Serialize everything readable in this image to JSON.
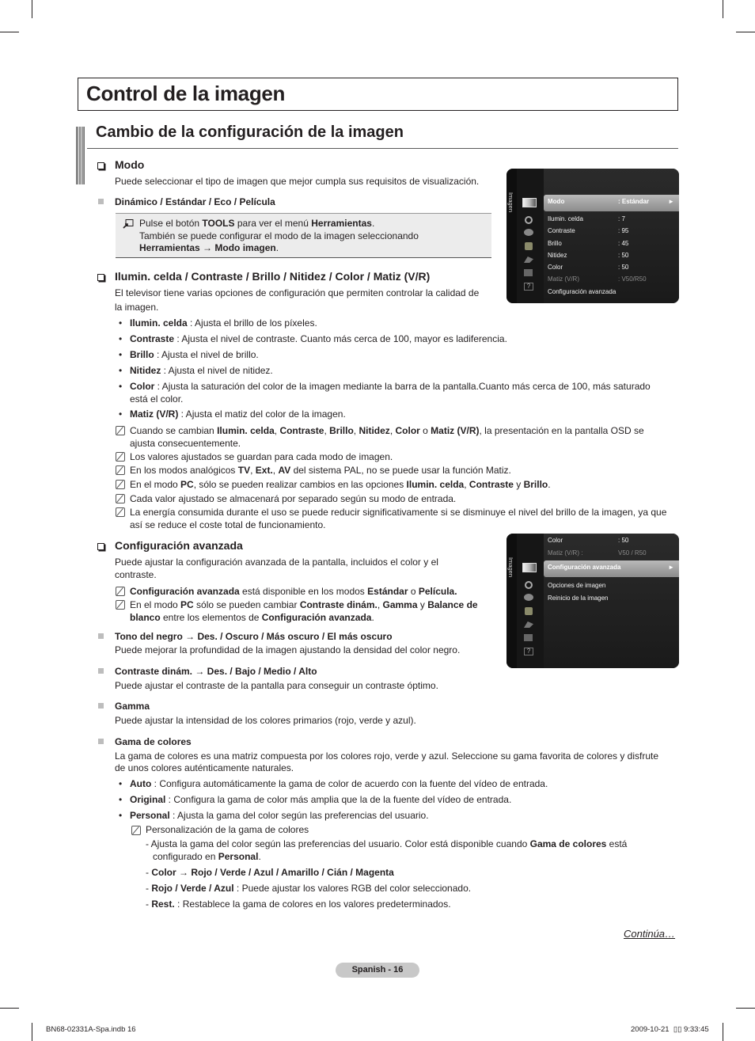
{
  "page": {
    "title": "Control de la imagen",
    "section_title": "Cambio de la configuración de la imagen",
    "continue_label": "Continúa…",
    "page_label": "Spanish - 16",
    "footer_left": "BN68-02331A-Spa.indb   16",
    "footer_right": "2009-10-21   \u0000 9:33:45"
  },
  "modo": {
    "heading": "Modo",
    "desc": "Puede seleccionar el tipo de imagen que mejor cumpla sus requisitos de visualización.",
    "options": [
      "Dinámico",
      "Estándar",
      "Eco",
      "Película"
    ],
    "tools_line1_a": "Pulse el botón ",
    "tools_line1_b": "TOOLS",
    "tools_line1_c": " para ver el menú ",
    "tools_line1_d": "Herramientas",
    "tools_line2": "También se puede configurar el modo de la imagen seleccionando",
    "tools_line3_a": "Herramientas → Modo imagen",
    "tools_line3_b": "."
  },
  "ajustes": {
    "heading": "Ilumin. celda / Contraste / Brillo / Nitidez / Color / Matiz (V/R)",
    "desc_line1": "El televisor tiene varias opciones de configuración que permiten controlar la calidad de",
    "desc_line2": "la imagen.",
    "bullets": [
      {
        "term": "Ilumin. celda",
        "text": " : Ajusta el brillo de los píxeles."
      },
      {
        "term": "Contraste",
        "text": " : Ajusta el nivel de contraste. Cuanto más cerca de 100, mayor es ladiferencia."
      },
      {
        "term": "Brillo",
        "text": " : Ajusta el nivel de brillo."
      },
      {
        "term": "Nitidez",
        "text": " : Ajusta el nivel de nitidez."
      },
      {
        "term": "Color",
        "text": " : Ajusta la saturación del color de la imagen mediante la barra de la pantalla.Cuanto más cerca de 100, más saturado",
        "text2": "está el color."
      },
      {
        "term": "Matiz (V/R)",
        "text": " : Ajusta el matiz del color de la imagen."
      }
    ],
    "notes": [
      {
        "a": "Cuando se cambian ",
        "b": "Ilumin. celda",
        "c": ", ",
        "d": "Contraste",
        "e": ", ",
        "f": "Brillo",
        "g": ", ",
        "h": "Nitidez",
        "i": ", ",
        "j": "Color",
        "k": " o ",
        "l": "Matiz (V/R)",
        "m": ", la presentación en la pantalla OSD se",
        "line2": "ajusta consecuentemente."
      },
      {
        "text": "Los valores ajustados se guardan para cada modo de imagen."
      },
      {
        "a": "En los modos analógicos ",
        "b": "TV",
        "c": ", ",
        "d": "Ext.",
        "e": ", ",
        "f": "AV",
        "g": " del sistema PAL, no se puede usar la función Matiz."
      },
      {
        "a": "En el modo ",
        "b": "PC",
        "c": ", sólo se pueden realizar cambios en las opciones ",
        "d": "Ilumin. celda",
        "e": ", ",
        "f": "Contraste",
        "g": " y ",
        "h": "Brillo",
        "i": "."
      },
      {
        "text": "Cada valor ajustado se almacenará por separado según su modo de entrada."
      },
      {
        "text": "La energía consumida durante el uso se puede reducir significativamente si se disminuye el nivel del brillo de la imagen, ya que",
        "line2": "así se reduce el coste total de funcionamiento."
      }
    ]
  },
  "avanzada": {
    "heading": "Configuración avanzada",
    "desc_line1": "Puede ajustar la configuración avanzada de la pantalla, incluidos el color y el",
    "desc_line2": "contraste.",
    "note1_a": "Configuración avanzada",
    "note1_b": " está disponible en los modos ",
    "note1_c": "Estándar",
    "note1_d": " o ",
    "note1_e": "Película.",
    "note2_a": "En el modo ",
    "note2_b": "PC",
    "note2_c": " sólo se pueden cambiar ",
    "note2_d": "Contraste dinám.",
    "note2_e": ", ",
    "note2_f": "Gamma",
    "note2_g": " y ",
    "note2_h": "Balance de",
    "note2_i": "blanco",
    "note2_j": " entre los elementos de ",
    "note2_k": "Configuración avanzada",
    "note2_l": ".",
    "items": [
      {
        "title": "Tono del negro → Des. / Oscuro / Más oscuro / El más oscuro",
        "desc": "Puede mejorar la profundidad de la imagen ajustando la densidad del color negro."
      },
      {
        "title": "Contraste dinám. → Des. / Bajo / Medio / Alto",
        "desc": "Puede ajustar el contraste de la pantalla para conseguir un contraste óptimo."
      },
      {
        "title": "Gamma",
        "desc": "Puede ajustar la intensidad de los colores primarios (rojo, verde y azul)."
      },
      {
        "title": "Gama de colores",
        "desc": "La gama de colores es una matriz compuesta por los colores rojo, verde y azul. Seleccione su gama favorita de colores y disfrute",
        "desc2": "de unos colores auténticamente naturales."
      }
    ],
    "gama_bullets": [
      {
        "term": "Auto",
        "text": " : Configura automáticamente la gama de color de acuerdo con la fuente del vídeo de entrada."
      },
      {
        "term": "Original",
        "text": " : Configura la gama de color más amplia que la de la fuente del vídeo de entrada."
      },
      {
        "term": "Personal",
        "text": " : Ajusta la gama del color según las preferencias del usuario."
      }
    ],
    "personal_note": "Personalización de la gama de colores",
    "dash_items": [
      {
        "a": "Ajusta la gama del color según las preferencias del usuario. Color está disponible cuando ",
        "b": "Gama de colores",
        "c": " está",
        "line2_a": "configurado en ",
        "line2_b": "Personal",
        "line2_c": "."
      },
      {
        "b": "Color → Rojo / Verde / Azul / Amarillo / Cián / Magenta"
      },
      {
        "b": "Rojo / Verde / Azul",
        "c": " : Puede ajustar los valores RGB del color seleccionado."
      },
      {
        "b": "Rest.",
        "c": " : Restablece la gama de colores en los valores predeterminados."
      }
    ]
  },
  "osd1": {
    "side_label": "Imagen",
    "selected": {
      "label": "Modo",
      "value": ": Estándar",
      "arrow": "►"
    },
    "rows": [
      {
        "label": "Ilumin. celda",
        "value": ": 7"
      },
      {
        "label": "Contraste",
        "value": ": 95"
      },
      {
        "label": "Brillo",
        "value": ": 45"
      },
      {
        "label": "Nitidez",
        "value": ": 50"
      },
      {
        "label": "Color",
        "value": ": 50"
      },
      {
        "label": "Matiz (V/R)",
        "value": ": V50/R50",
        "dim": true
      },
      {
        "label": "Configuración avanzada",
        "value": ""
      }
    ]
  },
  "osd2": {
    "side_label": "Imagen",
    "rows_above": [
      {
        "label": "Color",
        "value": ": 50"
      },
      {
        "label": "Matiz (V/R) :",
        "value": "V50 / R50",
        "dim": true
      }
    ],
    "selected": {
      "label": "Configuración avanzada",
      "value": "",
      "arrow": "►"
    },
    "rows": [
      {
        "label": "Opciones de imagen"
      },
      {
        "label": "Reinicio de la imagen"
      }
    ]
  },
  "colors": {
    "osd_bg": "#1c1c1c",
    "osd_selected": "#a8a8a8",
    "bullet_square": "#bdbdbd",
    "tools_box": "#ececec",
    "page_pill": "#c8c8c8"
  }
}
